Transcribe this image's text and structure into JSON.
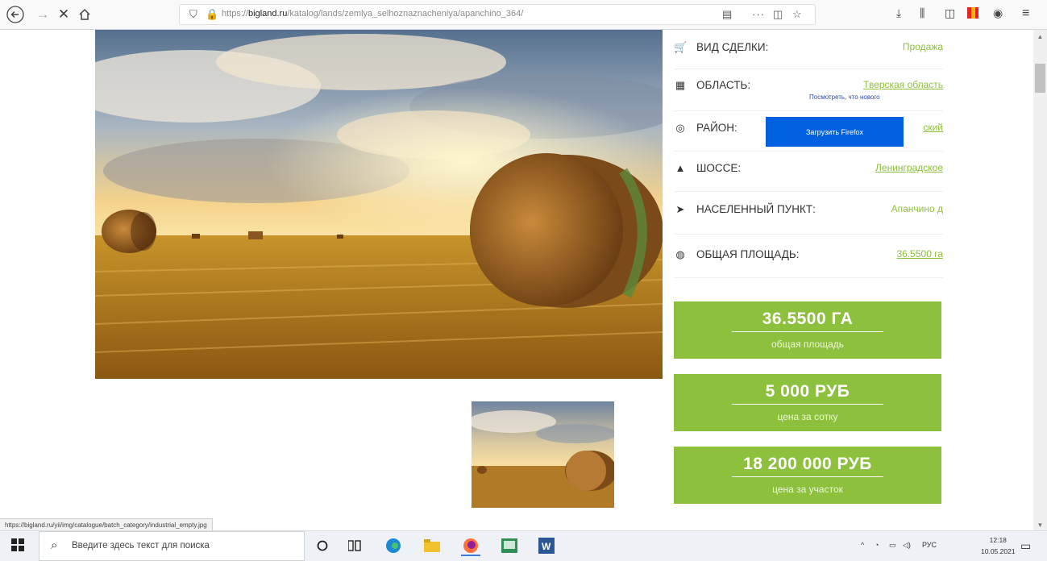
{
  "browser": {
    "url_prefix": "https://",
    "url_domain": "bigland.ru",
    "url_path": "/katalog/lands/zemlya_selhoznaznacheniya/apanchino_364/",
    "more_label": "···"
  },
  "details": [
    {
      "icon": "cart-icon",
      "glyph": "🛒",
      "label": "ВИД СДЕЛКИ:",
      "value": "Продажа"
    },
    {
      "icon": "map-icon",
      "glyph": "▦",
      "label": "ОБЛАСТЬ:",
      "value": "Тверская область"
    },
    {
      "icon": "target-icon",
      "glyph": "◎",
      "label": "РАЙОН:",
      "value": "ский"
    },
    {
      "icon": "road-icon",
      "glyph": "▲",
      "label": "ШОССЕ:",
      "value": "Ленинградское"
    },
    {
      "icon": "location-arrow-icon",
      "glyph": "➤",
      "label": "НАСЕЛЕННЫЙ ПУНКТ:",
      "value": "Апанчино д"
    },
    {
      "icon": "globe-icon",
      "glyph": "◍",
      "label": "ОБЩАЯ ПЛОЩАДЬ:",
      "value": "36.5500 га"
    }
  ],
  "notice": "Посмотреть, что нового",
  "firefox_button": "Загрузить Firefox",
  "prices": [
    {
      "value": "36.5500 ГА",
      "caption": "общая площадь"
    },
    {
      "value": "5 000 РУБ",
      "caption": "цена за сотку"
    },
    {
      "value": "18 200 000 РУБ",
      "caption": "цена за участок"
    }
  ],
  "status_url": "https://bigland.ru/yii/img/catalogue/batch_category/industrial_empty.jpg",
  "taskbar": {
    "search_placeholder": "Введите здесь текст для поиска",
    "lang": "РУС",
    "time": "12:18",
    "date": "10.05.2021"
  },
  "colors": {
    "accent": "#8dc03d",
    "firefox_blue": "#0060df"
  }
}
